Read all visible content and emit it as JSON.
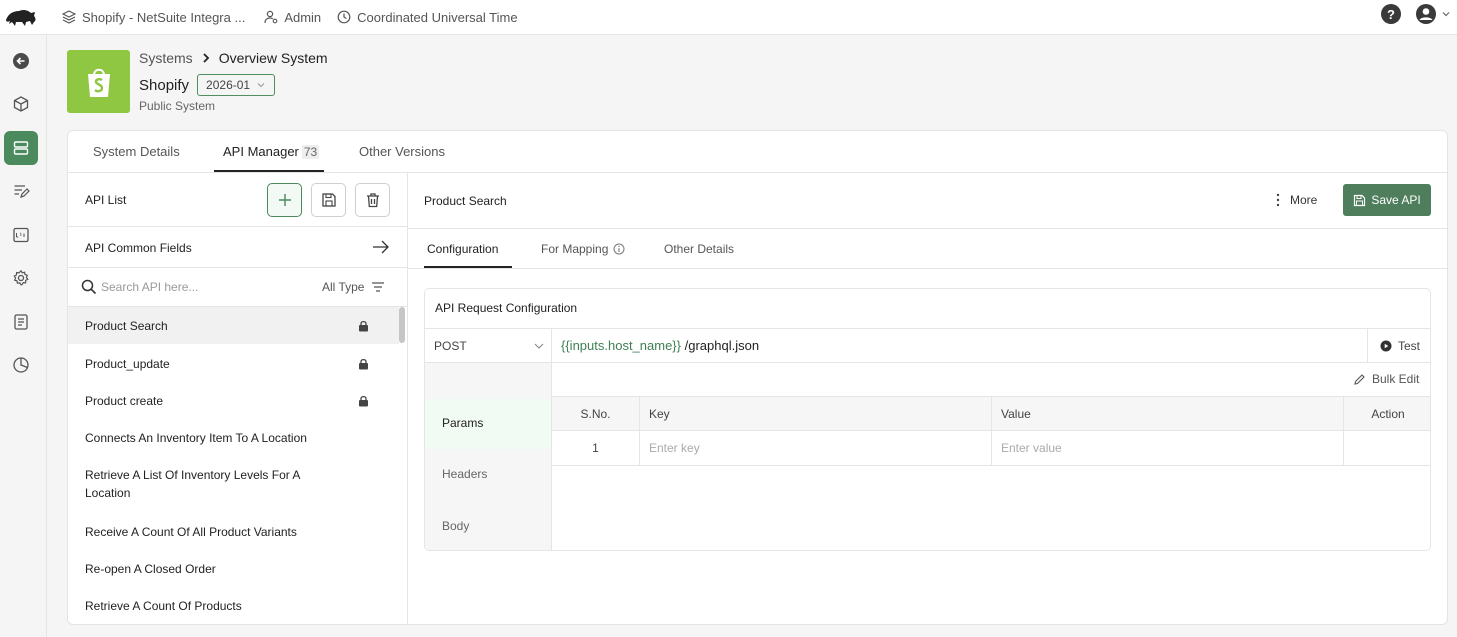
{
  "topbar": {
    "workspace": "Shopify - NetSuite Integra ...",
    "role": "Admin",
    "timezone": "Coordinated Universal Time",
    "help_label": "?"
  },
  "header": {
    "breadcrumb_parent": "Systems",
    "breadcrumb_current": "Overview System",
    "system_name": "Shopify",
    "version": "2026-01",
    "system_type": "Public System"
  },
  "tabs": {
    "system_details": "System Details",
    "api_manager": "API Manager",
    "api_count": "73",
    "other_versions": "Other Versions"
  },
  "api_panel": {
    "title": "API List",
    "common_fields": "API Common Fields",
    "search_placeholder": "Search API here...",
    "filter_label": "All Type",
    "items": [
      {
        "label": "Product Search",
        "locked": true
      },
      {
        "label": "Product_update",
        "locked": true
      },
      {
        "label": "Product create",
        "locked": true
      },
      {
        "label": "Connects An Inventory Item To A Location",
        "locked": false
      },
      {
        "label": "Retrieve A List Of Inventory Levels For A Location",
        "locked": false
      },
      {
        "label": "Receive A Count Of All Product Variants",
        "locked": false
      },
      {
        "label": "Re-open A Closed Order",
        "locked": false
      },
      {
        "label": "Retrieve A Count Of Products",
        "locked": false
      }
    ]
  },
  "detail": {
    "title": "Product Search",
    "more_label": "More",
    "save_label": "Save API",
    "subtabs": {
      "configuration": "Configuration",
      "for_mapping": "For Mapping",
      "other_details": "Other Details"
    },
    "request": {
      "title": "API Request Configuration",
      "method": "POST",
      "url_variable": "{{inputs.host_name}}",
      "url_path": "/graphql.json",
      "test_label": "Test",
      "side_items": [
        "Params",
        "Headers",
        "Body"
      ],
      "bulk_edit_label": "Bulk Edit",
      "columns": [
        "S.No.",
        "Key",
        "Value",
        "Action"
      ],
      "rows": [
        {
          "sno": "1",
          "key_placeholder": "Enter key",
          "value_placeholder": "Enter value"
        }
      ]
    }
  },
  "colors": {
    "accent_green": "#4f7e5d",
    "shopify_green": "#8fc642",
    "nav_active": "#4a8a5c"
  }
}
